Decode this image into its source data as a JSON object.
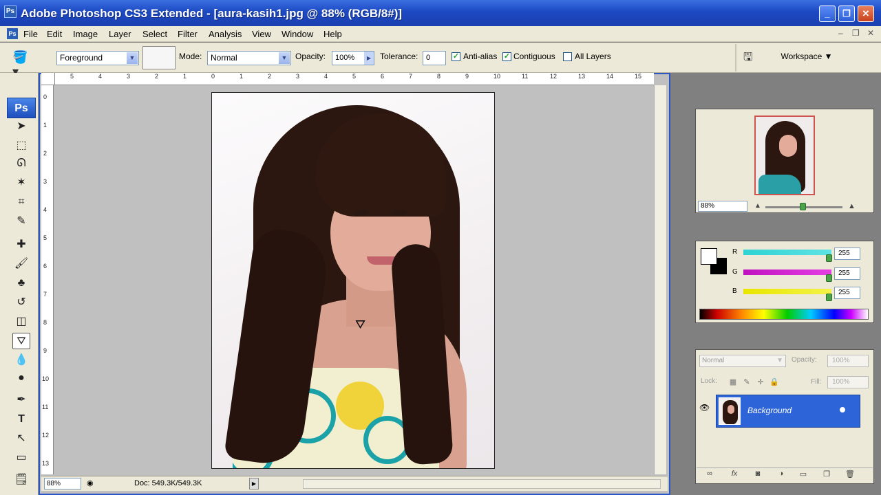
{
  "window": {
    "title": "Adobe Photoshop CS3 Extended - [aura-kasih1.jpg @ 88% (RGB/8#)]",
    "app_icon": "Ps"
  },
  "menu": [
    "File",
    "Edit",
    "Image",
    "Layer",
    "Select",
    "Filter",
    "Analysis",
    "View",
    "Window",
    "Help"
  ],
  "options": {
    "fill_source": "Foreground",
    "mode_label": "Mode:",
    "mode": "Normal",
    "opacity_label": "Opacity:",
    "opacity": "100%",
    "tolerance_label": "Tolerance:",
    "tolerance": "0",
    "anti_alias": "Anti-alias",
    "contiguous": "Contiguous",
    "all_layers": "All Layers",
    "workspace": "Workspace ▼"
  },
  "toolbox": {
    "logo": "Ps"
  },
  "document": {
    "zoom": "88%",
    "doc_info": "Doc: 549.3K/549.3K",
    "ruler_top": [
      "5",
      "4",
      "3",
      "2",
      "1",
      "0",
      "1",
      "2",
      "3",
      "4",
      "5",
      "6",
      "7",
      "8",
      "9",
      "10",
      "11",
      "12",
      "13",
      "14",
      "15"
    ],
    "ruler_left": [
      "0",
      "1",
      "2",
      "3",
      "4",
      "5",
      "6",
      "7",
      "8",
      "9",
      "10",
      "11",
      "12",
      "13"
    ]
  },
  "navigator": {
    "zoom": "88%"
  },
  "color": {
    "channels": [
      {
        "label": "R",
        "value": "255"
      },
      {
        "label": "G",
        "value": "255"
      },
      {
        "label": "B",
        "value": "255"
      }
    ]
  },
  "layers": {
    "blend_mode": "Normal",
    "opacity_label": "Opacity:",
    "opacity": "100%",
    "lock_label": "Lock:",
    "fill_label": "Fill:",
    "fill": "100%",
    "layer_name": "Background"
  }
}
